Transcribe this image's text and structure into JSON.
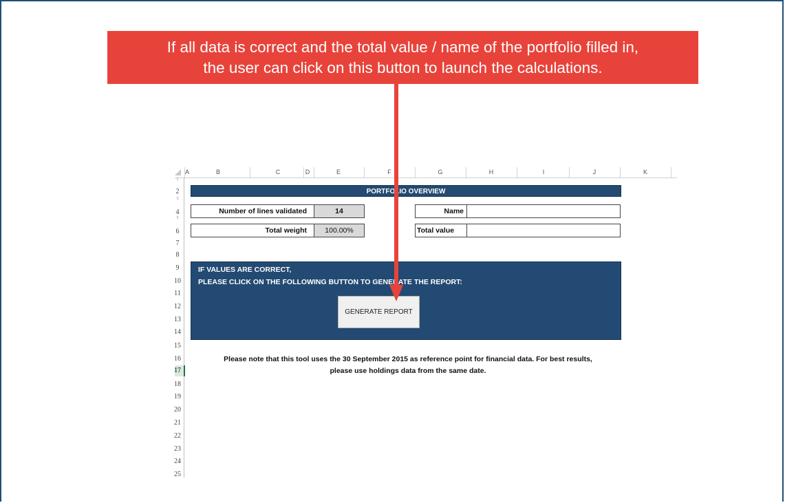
{
  "callout": {
    "line1": "If all data is correct and the total value / name of the portfolio filled in,",
    "line2": "the user can click on this button to launch the calculations."
  },
  "columns": [
    "A",
    "B",
    "C",
    "D",
    "E",
    "F",
    "G",
    "H",
    "I",
    "J",
    "K"
  ],
  "rows": [
    "1",
    "2",
    "3",
    "4",
    "5",
    "6",
    "7",
    "8",
    "9",
    "10",
    "11",
    "12",
    "13",
    "14",
    "15",
    "16",
    "17",
    "18",
    "19",
    "20",
    "21",
    "22",
    "23",
    "24",
    "25"
  ],
  "active_row": "17",
  "sheet": {
    "title": "PORTFOLIO OVERVIEW",
    "lines_validated_label": "Number of lines validated",
    "lines_validated_value": "14",
    "total_weight_label": "Total weight",
    "total_weight_value": "100.00%",
    "name_label": "Name",
    "name_value": "",
    "total_value_label": "Total value",
    "total_value_value": ""
  },
  "panel": {
    "line1": "IF VALUES ARE CORRECT,",
    "line2": "PLEASE CLICK ON THE FOLLOWING BUTTON TO GENERATE THE REPORT:",
    "button_label": "GENERATE REPORT"
  },
  "note": {
    "line1": "Please note that this tool uses the 30 September 2015 as reference point for financial data. For best results,",
    "line2": "please use holdings data from the same date."
  },
  "colors": {
    "callout": "#e8433a",
    "panel": "#234a72",
    "active_row": "#217346"
  }
}
